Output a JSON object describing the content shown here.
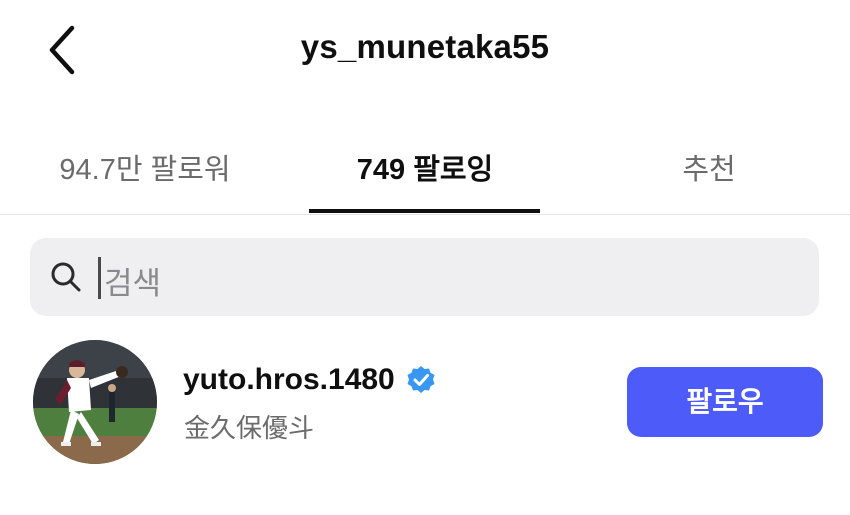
{
  "header": {
    "title": "ys_munetaka55",
    "back_icon": "chevron-left-icon"
  },
  "tabs": [
    {
      "label": "94.7만 팔로워",
      "active": false
    },
    {
      "label": "749 팔로잉",
      "active": true
    },
    {
      "label": "추천",
      "active": false
    }
  ],
  "search": {
    "placeholder": "검색",
    "icon": "search-icon"
  },
  "users": [
    {
      "username": "yuto.hros.1480",
      "full_name": "金久保優斗",
      "verified": true,
      "follow_label": "팔로우"
    }
  ],
  "colors": {
    "follow_button": "#4d5bf9",
    "verified_badge": "#3897f0",
    "search_bg": "#efeff1",
    "muted_text": "#6b6b6b"
  }
}
